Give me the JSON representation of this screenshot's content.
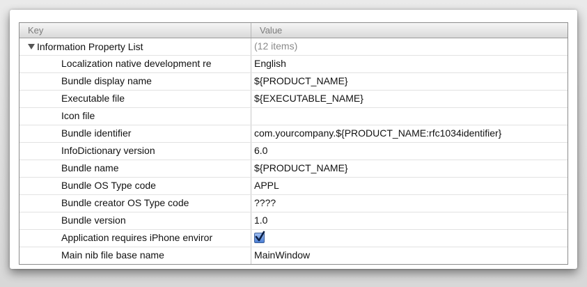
{
  "table": {
    "header_key": "Key",
    "header_value": "Value",
    "root": {
      "key": "Information Property List",
      "value": "(12 items)"
    },
    "rows": [
      {
        "key": "Localization native development re",
        "value": "English"
      },
      {
        "key": "Bundle display name",
        "value": "${PRODUCT_NAME}"
      },
      {
        "key": "Executable file",
        "value": "${EXECUTABLE_NAME}"
      },
      {
        "key": "Icon file",
        "value": ""
      },
      {
        "key": "Bundle identifier",
        "value": "com.yourcompany.${PRODUCT_NAME:rfc1034identifier}"
      },
      {
        "key": "InfoDictionary version",
        "value": "6.0"
      },
      {
        "key": "Bundle name",
        "value": "${PRODUCT_NAME}"
      },
      {
        "key": "Bundle OS Type code",
        "value": "APPL"
      },
      {
        "key": "Bundle creator OS Type code",
        "value": "????"
      },
      {
        "key": "Bundle version",
        "value": "1.0"
      },
      {
        "key": "Application requires iPhone enviror",
        "value_checkbox": true
      },
      {
        "key": "Main nib file base name",
        "value": "MainWindow"
      }
    ]
  },
  "colors": {
    "checkbox_fill": "#4c7fd4",
    "muted_text": "#8a8a8a"
  }
}
